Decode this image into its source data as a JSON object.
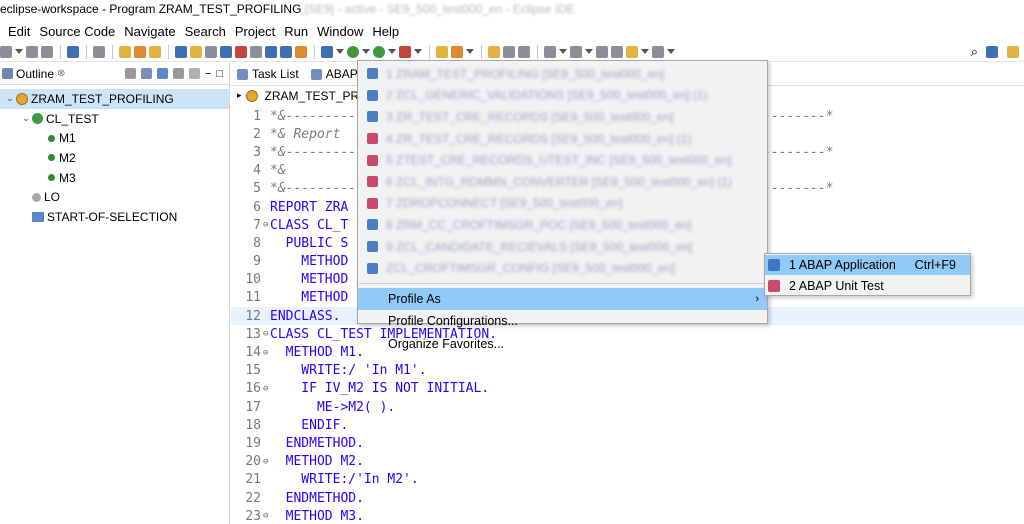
{
  "window": {
    "title": "eclipse-workspace - Program ZRAM_TEST_PROFILING",
    "title_blurred": "[SE9] - active - SE9_500_test000_en - Eclipse IDE"
  },
  "menubar": {
    "items": [
      "Edit",
      "Source Code",
      "Navigate",
      "Search",
      "Project",
      "Run",
      "Window",
      "Help"
    ]
  },
  "outline": {
    "tab_label": "Outline",
    "tab_suffix": "⊗",
    "tree": [
      {
        "label": "ZRAM_TEST_PROFILING",
        "level": 0,
        "twisty": "⌄",
        "icon": "program-icon",
        "selected": true
      },
      {
        "label": "CL_TEST",
        "level": 1,
        "twisty": "⌄",
        "icon": "class-icon"
      },
      {
        "label": "M1",
        "level": 2,
        "icon": "method-icon"
      },
      {
        "label": "M2",
        "level": 2,
        "icon": "method-icon"
      },
      {
        "label": "M3",
        "level": 2,
        "icon": "method-icon"
      },
      {
        "label": "LO",
        "level": 1,
        "icon": "local-object-icon"
      },
      {
        "label": "START-OF-SELECTION",
        "level": 1,
        "icon": "event-icon"
      }
    ]
  },
  "editor": {
    "tabs": [
      "Task List",
      "ABAP"
    ],
    "breadcrumb": "ZRAM_TEST_PRO",
    "lines": [
      {
        "n": "1",
        "fold": "",
        "text": "*&---------------------------------------------------------------------*",
        "cls": "cmt"
      },
      {
        "n": "2",
        "fold": "",
        "text": "*& Report",
        "cls": "cmt"
      },
      {
        "n": "3",
        "fold": "",
        "text": "*&---------------------------------------------------------------------*",
        "cls": "cmt"
      },
      {
        "n": "4",
        "fold": "",
        "text": "*&",
        "cls": "cmt"
      },
      {
        "n": "5",
        "fold": "",
        "text": "*&---------------------------------------------------------------------*",
        "cls": "cmt"
      },
      {
        "n": "6",
        "fold": "",
        "text": "REPORT ZRA",
        "cls": "kw"
      },
      {
        "n": "7",
        "fold": "⊖",
        "text": "CLASS CL_T",
        "cls": "kw"
      },
      {
        "n": "8",
        "fold": "",
        "text": "  PUBLIC S",
        "cls": "kw"
      },
      {
        "n": "9",
        "fold": "",
        "text": "    METHOD",
        "cls": "kw"
      },
      {
        "n": "10",
        "fold": "",
        "text": "    METHOD",
        "cls": "kw"
      },
      {
        "n": "11",
        "fold": "",
        "text": "    METHOD",
        "cls": "kw"
      },
      {
        "n": "12",
        "fold": "",
        "text": "ENDCLASS.",
        "cls": "kw",
        "current": true
      },
      {
        "n": "13",
        "fold": "⊖",
        "text": "CLASS CL_TEST IMPLEMENTATION.",
        "cls": "kw"
      },
      {
        "n": "14",
        "fold": "⊖",
        "text": "  METHOD M1.",
        "cls": "kw"
      },
      {
        "n": "15",
        "fold": "",
        "text": "    WRITE:/ 'In M1'.",
        "cls": "kw"
      },
      {
        "n": "16",
        "fold": "⊖",
        "text": "    IF IV_M2 IS NOT INITIAL.",
        "cls": "kw"
      },
      {
        "n": "17",
        "fold": "",
        "text": "      ME->M2( ).",
        "cls": "kw"
      },
      {
        "n": "18",
        "fold": "",
        "text": "    ENDIF.",
        "cls": "kw"
      },
      {
        "n": "19",
        "fold": "",
        "text": "  ENDMETHOD.",
        "cls": "kw"
      },
      {
        "n": "20",
        "fold": "⊖",
        "text": "  METHOD M2.",
        "cls": "kw"
      },
      {
        "n": "21",
        "fold": "",
        "text": "    WRITE:/'In M2'.",
        "cls": "kw"
      },
      {
        "n": "22",
        "fold": "",
        "text": "  ENDMETHOD.",
        "cls": "kw"
      },
      {
        "n": "23",
        "fold": "⊖",
        "text": "  METHOD M3.",
        "cls": "kw"
      }
    ]
  },
  "profile_dropdown": {
    "history": [
      {
        "label": "1 ZRAM_TEST_PROFILING [SE9_500_test000_en]",
        "icon": "abap-app-icon"
      },
      {
        "label": "2 ZCL_GENERIC_VALIDATIONS [SE9_500_test000_en] (1)",
        "icon": "abap-app-icon"
      },
      {
        "label": "3 ZR_TEST_CRE_RECORDS [SE9_500_test000_en]",
        "icon": "abap-app-icon"
      },
      {
        "label": "4 ZR_TEST_CRE_RECORDS [SE9_500_test000_en] (1)",
        "icon": "abap-unit-icon"
      },
      {
        "label": "5 ZTEST_CRE_RECORDS_UTEST_INC [SE9_500_test000_en]",
        "icon": "abap-unit-icon"
      },
      {
        "label": "6 ZCL_INTG_RDMMN_CONVERTER [SE9_500_test000_en] (1)",
        "icon": "abap-unit-icon"
      },
      {
        "label": "7 ZDROPCONNECT [SE9_500_test000_en]",
        "icon": "abap-unit-icon"
      },
      {
        "label": "8 ZRM_CC_CROFTIMSGR_POC [SE9_500_test000_en]",
        "icon": "abap-app-icon"
      },
      {
        "label": "9 ZCL_CANDIDATE_RECIEVALS [SE9_500_test000_en]",
        "icon": "abap-app-icon"
      },
      {
        "label": "ZCL_CROFTIMSGR_CONFIG [SE9_500_test000_en]",
        "icon": "abap-app-icon"
      }
    ],
    "profile_as": "Profile As",
    "profile_configurations": "Profile Configurations...",
    "organize_favorites": "Organize Favorites..."
  },
  "profile_as_submenu": {
    "items": [
      {
        "label": "1 ABAP Application",
        "accelerator": "Ctrl+F9",
        "icon": "abap-app-icon",
        "active": true
      },
      {
        "label": "2 ABAP Unit Test",
        "accelerator": "",
        "icon": "abap-unit-icon",
        "active": false
      }
    ]
  }
}
